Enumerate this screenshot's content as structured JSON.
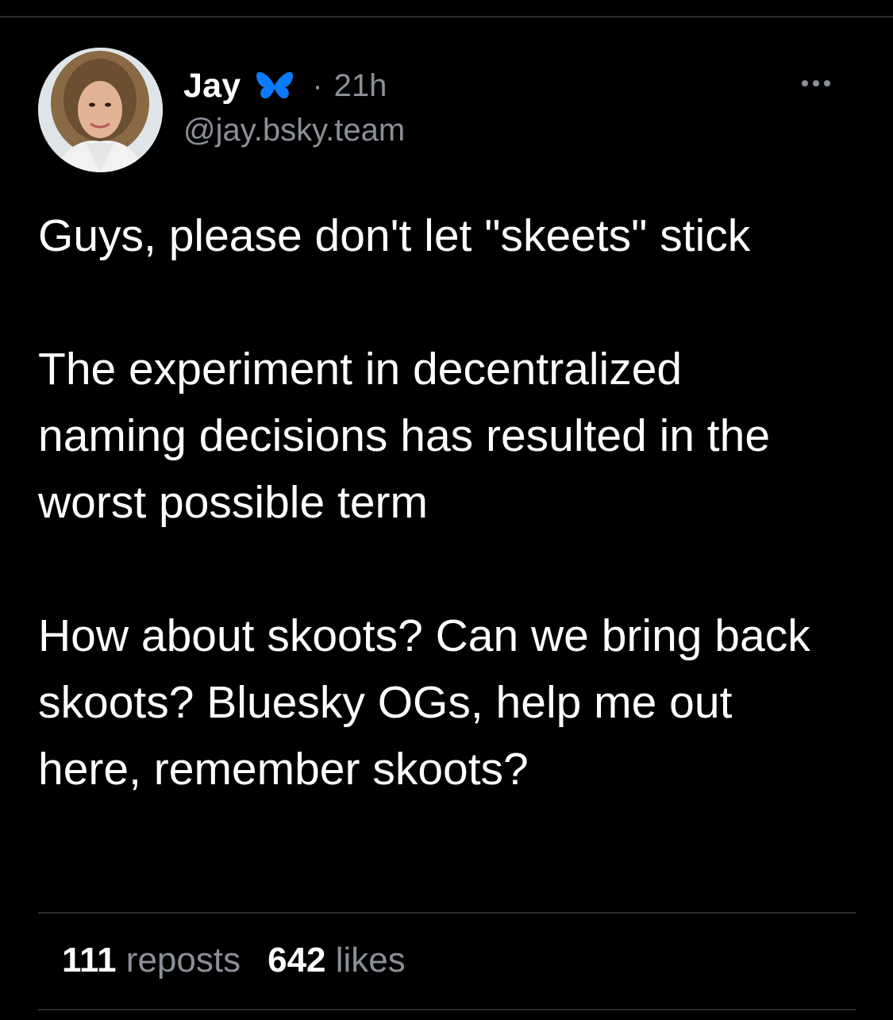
{
  "post": {
    "author": {
      "display_name": "Jay",
      "handle": "@jay.bsky.team",
      "badge_icon": "butterfly-icon",
      "avatar": "avatar"
    },
    "separator": "·",
    "time": "21h",
    "more_icon": "more-options-icon",
    "paragraphs": [
      "Guys, please don't let \"skeets\" stick",
      "The experiment in decentralized naming decisions has resulted in the worst possible term",
      "How about skoots? Can we bring back skoots? Bluesky OGs, help me out here, remember skoots?"
    ],
    "stats": {
      "reposts_count": "111",
      "reposts_label": "reposts",
      "likes_count": "642",
      "likes_label": "likes"
    }
  },
  "colors": {
    "background": "#000000",
    "text": "#ffffff",
    "muted": "#8b8f97",
    "divider": "#2a2d33",
    "butterfly": "#0a7aff"
  }
}
